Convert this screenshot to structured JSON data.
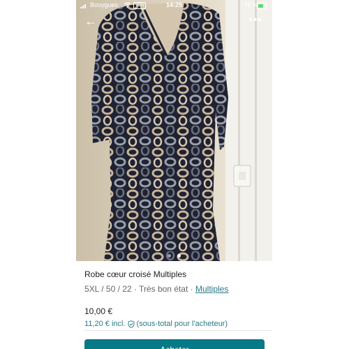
{
  "status_bar": {
    "carrier": "Bouygues",
    "vpn": "VPN",
    "time": "14:25",
    "battery": "72 %"
  },
  "nav": {
    "back_icon": "arrow-left-icon",
    "more_icon": "more-horizontal-icon"
  },
  "gallery": {
    "photo_description_icon": "dress-photo",
    "pagination": {
      "count": 2,
      "active_index": 1
    }
  },
  "listing": {
    "title": "Robe cœur croisé Multiples",
    "size_and_condition": "5XL / 50 / 22 · Très bon état ·",
    "brand_link": "Multiples",
    "price": "10,00 €",
    "price_incl": "11,20 € incl.",
    "protection_note": "(sous-total pour l'acheteur)"
  },
  "actions": {
    "buy_label": "Acheter"
  },
  "colors": {
    "accent": "#067a86",
    "link": "#2a7a88"
  }
}
